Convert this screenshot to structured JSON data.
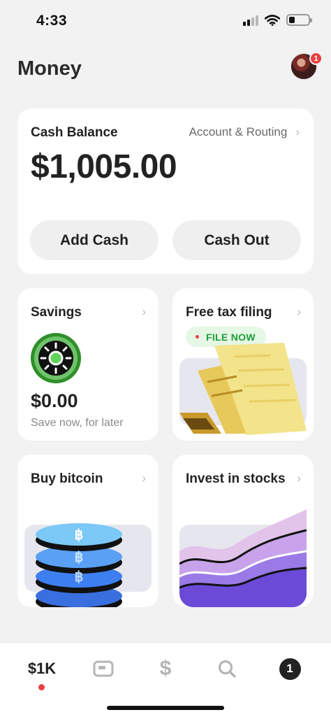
{
  "status_bar": {
    "time": "4:33"
  },
  "header": {
    "title": "Money",
    "notification_count": "1"
  },
  "balance": {
    "label": "Cash Balance",
    "link_label": "Account & Routing",
    "amount": "$1,005.00",
    "add_cash_label": "Add Cash",
    "cash_out_label": "Cash Out"
  },
  "tiles": {
    "savings": {
      "title": "Savings",
      "amount": "$0.00",
      "subtitle": "Save now, for later"
    },
    "tax": {
      "title": "Free tax filing",
      "badge": "FILE NOW"
    },
    "bitcoin": {
      "title": "Buy bitcoin"
    },
    "stocks": {
      "title": "Invest in stocks"
    }
  },
  "tab_bar": {
    "money_label": "$1K",
    "activity_count": "1"
  },
  "icons": {
    "money_tab": "money-tab-icon",
    "card_tab": "card-icon",
    "pay_tab": "dollar-icon",
    "search_tab": "search-icon",
    "activity_tab": "activity-icon"
  },
  "colors": {
    "accent_green": "#1e9e3a",
    "badge_red": "#e74040",
    "background": "#f2f2f2"
  }
}
